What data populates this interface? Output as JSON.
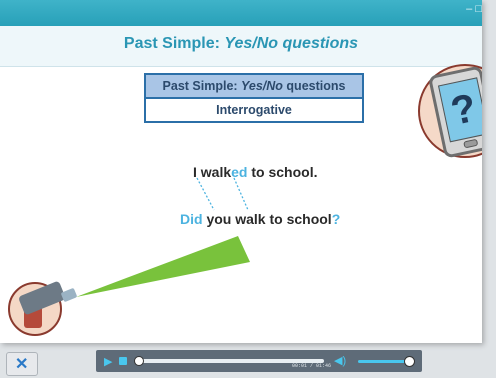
{
  "window": {
    "controls": "– □"
  },
  "slide": {
    "title_main": "Past Simple: ",
    "title_em": "Yes/No questions",
    "table": {
      "header_main": "Past Simple: ",
      "header_em": "Yes/No",
      "header_tail": " questions",
      "row": "Interrogative"
    },
    "sentence1": {
      "a": "I walk",
      "b": "ed",
      "c": " to school."
    },
    "sentence2": {
      "a": "Did",
      "b": " you walk to school",
      "c": "?"
    }
  },
  "icons": {
    "phone": "phone-question-icon",
    "projector": "projector-icon",
    "tool": "tool-icon"
  },
  "player": {
    "time": "00:01 / 01:46",
    "progress": 0.0,
    "volume": 0.9
  },
  "colors": {
    "accent": "#2a96b4",
    "highlight": "#4cb3e0",
    "table_border": "#2b6fa8",
    "table_header": "#a9c5e6",
    "beam": "#79c23c"
  }
}
